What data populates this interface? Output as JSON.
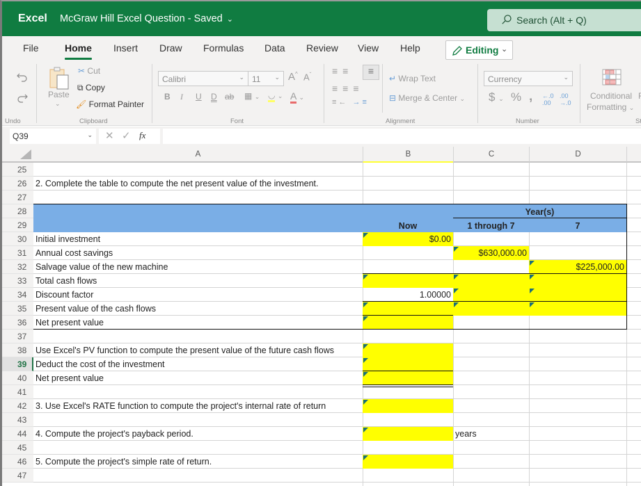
{
  "titlebar": {
    "app_name": "Excel",
    "doc_title": "McGraw Hill Excel Question",
    "save_status": "Saved",
    "search_placeholder": "Search (Alt + Q)"
  },
  "tabs": [
    "File",
    "Home",
    "Insert",
    "Draw",
    "Formulas",
    "Data",
    "Review",
    "View",
    "Help"
  ],
  "active_tab": "Home",
  "mode_button": "Editing",
  "ribbon": {
    "undo_label": "Undo",
    "clipboard": {
      "paste": "Paste",
      "cut": "Cut",
      "copy": "Copy",
      "format_painter": "Format Painter",
      "group": "Clipboard"
    },
    "font": {
      "name": "Calibri",
      "size": "11",
      "group": "Font"
    },
    "alignment": {
      "wrap_text": "Wrap Text",
      "merge_center": "Merge & Center",
      "group": "Alignment"
    },
    "number": {
      "format": "Currency",
      "group": "Number"
    },
    "styles": {
      "conditional_formatting_1": "Conditional",
      "conditional_formatting_2": "Formatting",
      "next_cut": "F",
      "group_cut": "St"
    },
    "colors": {
      "highlight": "#ffff00",
      "font_color": "#e04040"
    }
  },
  "formula_bar": {
    "name_box": "Q39",
    "fx": "fx",
    "content": ""
  },
  "columns": [
    "A",
    "B",
    "C",
    "D"
  ],
  "rows": [
    "25",
    "26",
    "27",
    "28",
    "29",
    "30",
    "31",
    "32",
    "33",
    "34",
    "35",
    "36",
    "37",
    "38",
    "39",
    "40",
    "41",
    "42",
    "43",
    "44",
    "45",
    "46",
    "47"
  ],
  "selected_row": "39",
  "sheet": {
    "r26": "2. Complete the table to compute the net present value of the investment.",
    "header": {
      "years": "Year(s)",
      "now": "Now",
      "c1": "1 through 7",
      "c2": "7"
    },
    "labels": {
      "r30": "Initial investment",
      "r31": "Annual cost savings",
      "r32": "Salvage value of the new machine",
      "r33": "Total cash flows",
      "r34": "Discount factor",
      "r35": "Present value of the cash flows",
      "r36": "Net present value",
      "r38": "Use Excel's PV function to compute the present value of the future cash flows",
      "r39": "Deduct the cost of the investment",
      "r40": "Net present value",
      "r42": "3. Use Excel's RATE function to compute the project's internal rate of return",
      "r44": "4. Compute the project's payback period.",
      "r46": "5. Compute the project's simple rate of return."
    },
    "values": {
      "b30": "$0.00",
      "c31": "$630,000.00",
      "d32": "$225,000.00",
      "b34": "1.00000",
      "c44": "years"
    },
    "input_color": "#ffff00",
    "header_color": "#7aaee6"
  }
}
